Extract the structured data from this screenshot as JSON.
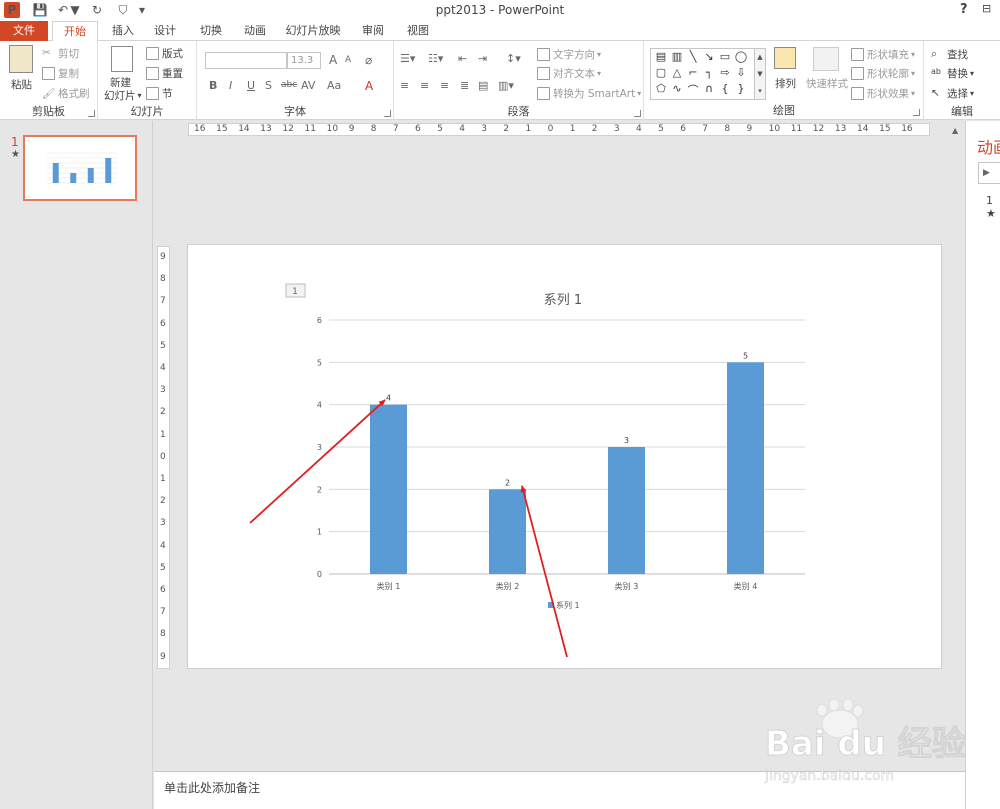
{
  "app": {
    "title": "ppt2013 - PowerPoint",
    "help": "?",
    "logo": "P"
  },
  "tabs": [
    "文件",
    "开始",
    "插入",
    "设计",
    "切换",
    "动画",
    "幻灯片放映",
    "审阅",
    "视图"
  ],
  "ribbon": {
    "clipboard": {
      "label": "剪贴板",
      "paste": "粘贴",
      "cut": "剪切",
      "copy": "复制",
      "format_painter": "格式刷"
    },
    "slides": {
      "label": "幻灯片",
      "new_slide_1": "新建",
      "new_slide_2": "幻灯片",
      "layout": "版式",
      "reset": "重置",
      "section": "节"
    },
    "font": {
      "label": "字体",
      "font_name": "",
      "font_size": "13.3",
      "bold": "B",
      "italic": "I",
      "underline": "U",
      "strike": "S",
      "shadow": "abc",
      "spacing": "AV",
      "case": "Aa",
      "color": "A",
      "grow": "A",
      "shrink": "A"
    },
    "paragraph": {
      "label": "段落",
      "text_direction": "文字方向",
      "align_text": "对齐文本",
      "convert_smartart": "转换为 SmartArt"
    },
    "drawing": {
      "label": "绘图",
      "arrange": "排列",
      "quick_styles": "快速样式",
      "shape_fill": "形状填充",
      "shape_outline": "形状轮廓",
      "shape_effects": "形状效果"
    },
    "editing": {
      "label": "编辑",
      "find": "查找",
      "replace": "替换",
      "select": "选择"
    }
  },
  "thumbnail_pane": {
    "slide_number": "1",
    "star": "★"
  },
  "ruler": {
    "horizontal": [
      "16",
      "15",
      "14",
      "13",
      "12",
      "11",
      "10",
      "9",
      "8",
      "7",
      "6",
      "5",
      "4",
      "3",
      "2",
      "1",
      "0",
      "1",
      "2",
      "3",
      "4",
      "5",
      "6",
      "7",
      "8",
      "9",
      "10",
      "11",
      "12",
      "13",
      "14",
      "15",
      "16"
    ],
    "vertical": [
      "9",
      "8",
      "7",
      "6",
      "5",
      "4",
      "3",
      "2",
      "1",
      "0",
      "1",
      "2",
      "3",
      "4",
      "5",
      "6",
      "7",
      "8",
      "9"
    ]
  },
  "slide": {
    "tag": "1"
  },
  "chart_data": {
    "type": "bar",
    "title": "系列 1",
    "categories": [
      "类别 1",
      "类别 2",
      "类别 3",
      "类别 4"
    ],
    "series": [
      {
        "name": "系列 1",
        "values": [
          4,
          2,
          3,
          5
        ],
        "color": "#5b9bd5"
      }
    ],
    "ylim": [
      0,
      6
    ],
    "yticks": [
      "0",
      "1",
      "2",
      "3",
      "4",
      "5",
      "6"
    ],
    "data_labels": [
      "4",
      "2",
      "3",
      "5"
    ],
    "grid": true,
    "legend": "bottom",
    "annotations": [
      {
        "type": "arrow",
        "color": "#e02020",
        "points_to": "类别 1 data label"
      },
      {
        "type": "arrow",
        "color": "#e02020",
        "points_to": "类别 2 data label"
      }
    ]
  },
  "notes": {
    "placeholder": "单击此处添加备注"
  },
  "animation_pane": {
    "title": "动画窗格",
    "play": "▶",
    "item": "1 ★"
  },
  "watermark": {
    "brand": "Bai du 经验",
    "url": "jingyan.baidu.com"
  }
}
